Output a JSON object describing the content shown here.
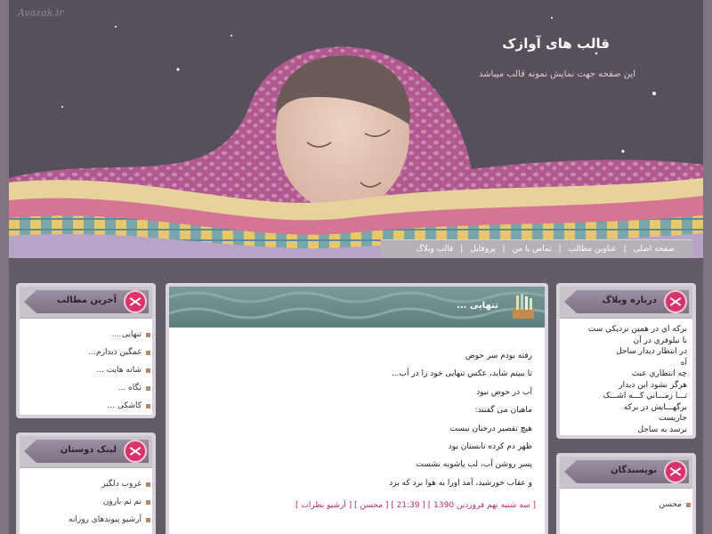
{
  "header": {
    "logo_text": "Avazak.ir",
    "site_title": "قالب های آوازک",
    "site_desc": "این صفحه جهت نمایش نمونه قالب میباشد"
  },
  "nav": {
    "items": [
      "صفحه اصلی",
      "عناوین مطالب",
      "تماس با من",
      "پروفایل",
      "قالب وبلاگ"
    ]
  },
  "sidebar_left": {
    "recent": {
      "title": "آخرین مطالب",
      "items": [
        "تنهایی ...",
        "غمگین دیدارم...",
        "شانه هایت ...",
        "نگاه ...",
        "کاشکی ..."
      ]
    },
    "links": {
      "title": "لینک دوستان",
      "items": [
        "غروب دلگیر",
        "نم نم بارون",
        "آرشیو پیوندهای روزانه"
      ]
    }
  },
  "sidebar_right": {
    "about": {
      "title": "درباره وبلاگ",
      "lines": [
        "برکه اي در همين نزديکي ست",
        "با نيلوفري در آن",
        "در انتظار ديدار ساحل",
        "آه",
        "چه انتظاري عبث",
        "هرگز نشود اين ديدار",
        "تـــا زمـــاني کـــه اشـــک برگهـــايش در برکه",
        "جاريست",
        "نرسد به ساحل"
      ]
    },
    "authors": {
      "title": "نویسندگان",
      "items": [
        "محسن"
      ]
    }
  },
  "post": {
    "title": "تنهایی ...",
    "lines": [
      "رفته بودم سر حوض",
      "تا ببینم شاید، عکس تنهایی خود را در آب...",
      "آب در حوض نبود",
      "ماهیان می گفتند:",
      "هیچ تقصیر درختان نیست",
      "ظهر دم کرده تابستان بود",
      "پسر روشن آب، لب پاشویه نشست",
      "و عقاب خورشید، آمد اورا به هوا برد که برد"
    ],
    "meta": "[ سه شنبه نهم فروردین 1390 ] [ 21:39 ] [ محسن ] [ آرشیو نظرات ]"
  },
  "colors": {
    "accent_pink": "#c2266b",
    "header_bg": "#55505a",
    "frame_bg": "#6e6670"
  }
}
